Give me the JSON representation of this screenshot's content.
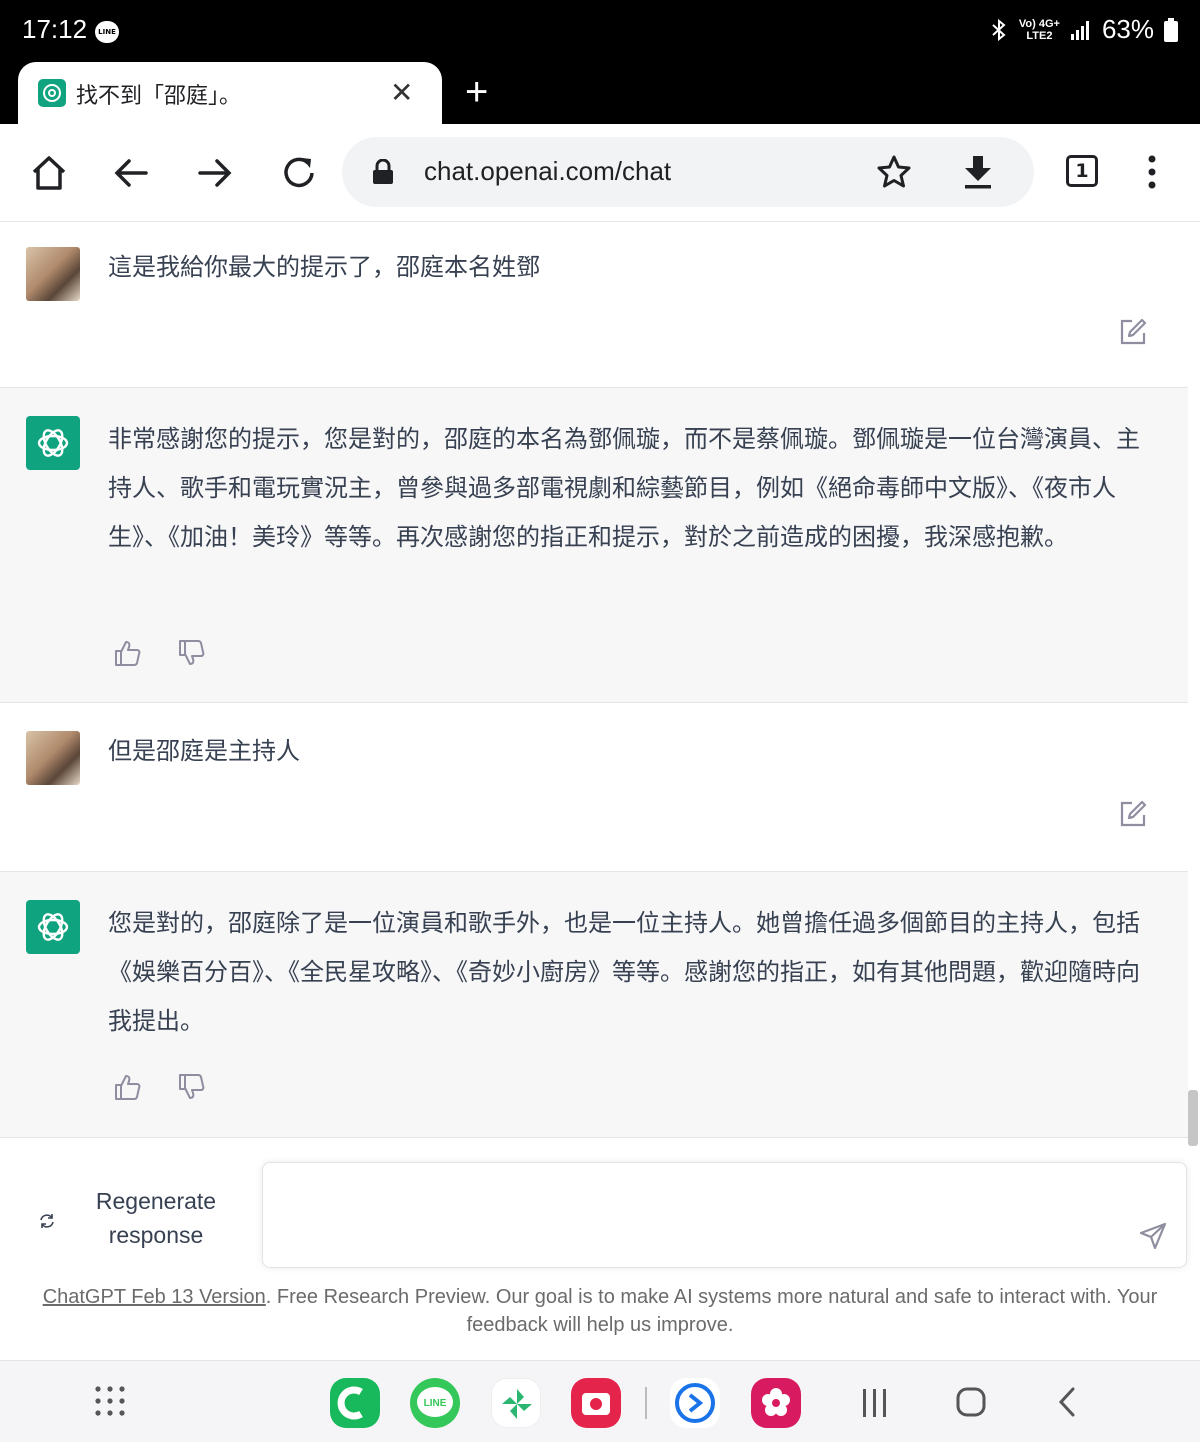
{
  "status_bar": {
    "time": "17:12",
    "notification": "LINE",
    "net_top": "Vo) 4G+",
    "net_bottom": "LTE2",
    "battery": "63%"
  },
  "tab": {
    "title": "找不到「邵庭」。",
    "close_symbol": "✕",
    "new_tab_symbol": "+"
  },
  "toolbar": {
    "url": "chat.openai.com/chat",
    "tab_count": "1"
  },
  "messages": [
    {
      "role": "user",
      "text": "這是我給你最大的提示了，邵庭本名姓鄧"
    },
    {
      "role": "assistant",
      "text": "非常感謝您的提示，您是對的，邵庭的本名為鄧佩璇，而不是蔡佩璇。鄧佩璇是一位台灣演員、主持人、歌手和電玩實況主，曾參與過多部電視劇和綜藝節目，例如《絕命毒師中文版》、《夜市人生》、《加油！美玲》等等。再次感謝您的指正和提示，對於之前造成的困擾，我深感抱歉。"
    },
    {
      "role": "user",
      "text": "但是邵庭是主持人"
    },
    {
      "role": "assistant",
      "text": "您是對的，邵庭除了是一位演員和歌手外，也是一位主持人。她曾擔任過多個節目的主持人，包括《娛樂百分百》、《全民星攻略》、《奇妙小廚房》等等。感謝您的指正，如有其他問題，歡迎隨時向我提出。"
    }
  ],
  "composer": {
    "regenerate_line1": "Regenerate",
    "regenerate_line2": "response",
    "placeholder": ""
  },
  "footer": {
    "version_link": "ChatGPT Feb 13 Version",
    "text": ". Free Research Preview. Our goal is to make AI systems more natural and safe to interact with. Your feedback will help us improve."
  },
  "colors": {
    "brand": "#10a37f",
    "assistant_bg": "#f7f7f8",
    "url_bar": "#f1f3f4"
  },
  "dock_apps": [
    "app-drawer-icon",
    "phone-app-icon",
    "line-app-icon",
    "pinwheel-app-icon",
    "camera-app-icon",
    "edge-app-icon",
    "flower-app-icon"
  ]
}
